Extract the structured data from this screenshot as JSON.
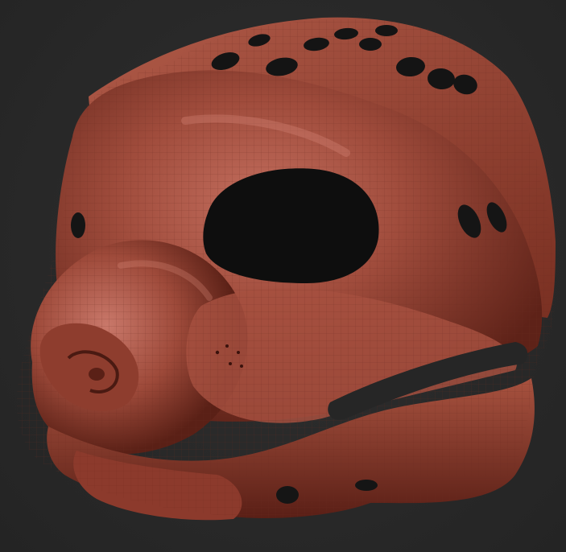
{
  "scene": {
    "subject": "",
    "colors": {
      "background": "#2a2a2a",
      "clay": "#a04c3c",
      "clay_highlight": "#c9786a",
      "clay_shadow": "#5e2218",
      "hole": "#111111",
      "mouth_gap": "#262626"
    }
  }
}
